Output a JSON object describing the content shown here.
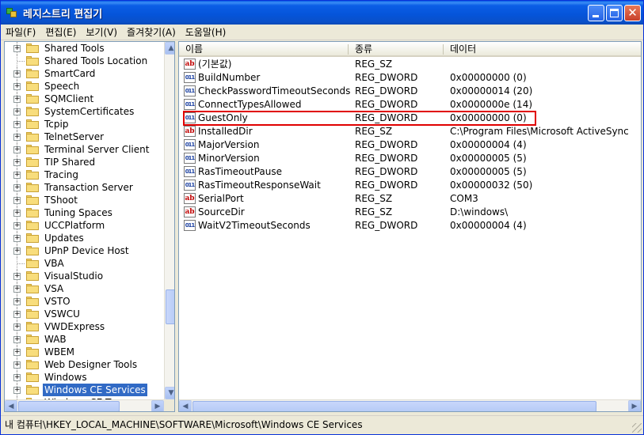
{
  "window": {
    "title": "레지스트리 편집기"
  },
  "menu": [
    "파일(F)",
    "편집(E)",
    "보기(V)",
    "즐겨찾기(A)",
    "도움말(H)"
  ],
  "tree": {
    "items": [
      {
        "label": "Shared Tools",
        "expandable": true
      },
      {
        "label": "Shared Tools Location",
        "expandable": false
      },
      {
        "label": "SmartCard",
        "expandable": true
      },
      {
        "label": "Speech",
        "expandable": true
      },
      {
        "label": "SQMClient",
        "expandable": true
      },
      {
        "label": "SystemCertificates",
        "expandable": true
      },
      {
        "label": "Tcpip",
        "expandable": true
      },
      {
        "label": "TelnetServer",
        "expandable": true
      },
      {
        "label": "Terminal Server Client",
        "expandable": true
      },
      {
        "label": "TIP Shared",
        "expandable": true
      },
      {
        "label": "Tracing",
        "expandable": true
      },
      {
        "label": "Transaction Server",
        "expandable": true
      },
      {
        "label": "TShoot",
        "expandable": true
      },
      {
        "label": "Tuning Spaces",
        "expandable": true
      },
      {
        "label": "UCCPlatform",
        "expandable": true
      },
      {
        "label": "Updates",
        "expandable": true
      },
      {
        "label": "UPnP Device Host",
        "expandable": true
      },
      {
        "label": "VBA",
        "expandable": false
      },
      {
        "label": "VisualStudio",
        "expandable": true
      },
      {
        "label": "VSA",
        "expandable": true
      },
      {
        "label": "VSTO",
        "expandable": true
      },
      {
        "label": "VSWCU",
        "expandable": true
      },
      {
        "label": "VWDExpress",
        "expandable": true
      },
      {
        "label": "WAB",
        "expandable": true
      },
      {
        "label": "WBEM",
        "expandable": true
      },
      {
        "label": "Web Designer Tools",
        "expandable": true
      },
      {
        "label": "Windows",
        "expandable": true
      },
      {
        "label": "Windows CE Services",
        "expandable": true,
        "selected": true
      },
      {
        "label": "Windows CE T...",
        "expandable": true
      }
    ]
  },
  "columns": {
    "name": "이름",
    "type": "종류",
    "data": "데이터"
  },
  "values": [
    {
      "icon": "sz",
      "name": "(기본값)",
      "type": "REG_SZ",
      "data": ""
    },
    {
      "icon": "dw",
      "name": "BuildNumber",
      "type": "REG_DWORD",
      "data": "0x00000000 (0)"
    },
    {
      "icon": "dw",
      "name": "CheckPasswordTimeoutSeconds",
      "type": "REG_DWORD",
      "data": "0x00000014 (20)"
    },
    {
      "icon": "dw",
      "name": "ConnectTypesAllowed",
      "type": "REG_DWORD",
      "data": "0x0000000e (14)"
    },
    {
      "icon": "dw",
      "name": "GuestOnly",
      "type": "REG_DWORD",
      "data": "0x00000000 (0)"
    },
    {
      "icon": "sz",
      "name": "InstalledDir",
      "type": "REG_SZ",
      "data": "C:\\Program Files\\Microsoft ActiveSync"
    },
    {
      "icon": "dw",
      "name": "MajorVersion",
      "type": "REG_DWORD",
      "data": "0x00000004 (4)"
    },
    {
      "icon": "dw",
      "name": "MinorVersion",
      "type": "REG_DWORD",
      "data": "0x00000005 (5)"
    },
    {
      "icon": "dw",
      "name": "RasTimeoutPause",
      "type": "REG_DWORD",
      "data": "0x00000005 (5)"
    },
    {
      "icon": "dw",
      "name": "RasTimeoutResponseWait",
      "type": "REG_DWORD",
      "data": "0x00000032 (50)"
    },
    {
      "icon": "sz",
      "name": "SerialPort",
      "type": "REG_SZ",
      "data": "COM3"
    },
    {
      "icon": "sz",
      "name": "SourceDir",
      "type": "REG_SZ",
      "data": "D:\\windows\\"
    },
    {
      "icon": "dw",
      "name": "WaitV2TimeoutSeconds",
      "type": "REG_DWORD",
      "data": "0x00000004 (4)"
    }
  ],
  "icons": {
    "sz": "ab",
    "dw": "011"
  },
  "status": "내 컴퓨터\\HKEY_LOCAL_MACHINE\\SOFTWARE\\Microsoft\\Windows CE Services",
  "colors": {
    "titlebar": "#0554d9",
    "selection": "#316ac5",
    "highlight_box": "#e00000"
  }
}
